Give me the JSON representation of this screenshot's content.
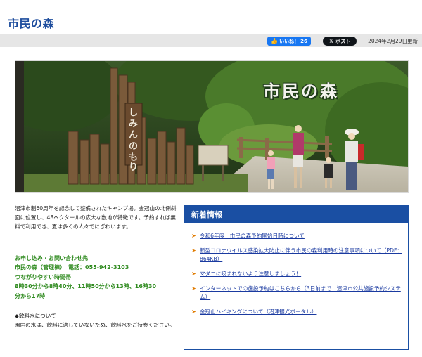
{
  "header": {
    "title": "市民の森"
  },
  "share_bar": {
    "like_label": "いいね！",
    "like_count": "26",
    "post_label": "ポスト",
    "updated": "2024年2月29日更新"
  },
  "hero": {
    "title": "市民の森",
    "sign_text": "しみんのもり"
  },
  "intro": {
    "text": "沼津市制60周年を記念して整備されたキャンプ場。金冠山の北側斜面に位置し、48ヘクタールの広大な敷地が特徴です。予約すれば無料で利用でき、夏は多くの人々でにぎわいます。"
  },
  "contact": {
    "line1": "お申し込み・お問い合わせ先",
    "line2": "市民の森（管理棟）　電話：055-942-3103",
    "line3": "つながりやすい時間帯",
    "line4": "8時30分から8時40分、11時50分から13時、16時30",
    "line5": "分から17時"
  },
  "water": {
    "heading": "◆飲料水について",
    "text": "園内の水は、飲料に適していないため、飲料水をご持参ください。"
  },
  "news": {
    "heading": "新着情報",
    "items": [
      {
        "label": "令和6年度　市民の森予約開始日時について"
      },
      {
        "label": "新型コロナウイルス感染拡大防止に伴う市民の森利用時の注意事項について（PDF：864KB）"
      },
      {
        "label": "マダニに咬まれないよう注意しましょう！"
      },
      {
        "label": "インターネットでの施設予約はこちらから（3日前まで　沼津市公共施設予約システム）"
      },
      {
        "label": "金冠山ハイキングについて（沼津観光ポータル）"
      }
    ]
  },
  "colors": {
    "title_blue": "#1f4e9e",
    "news_blue": "#1a4fa3",
    "contact_green": "#2e8a1e",
    "arrow_orange": "#e07b00",
    "facebook_blue": "#1877f2"
  }
}
